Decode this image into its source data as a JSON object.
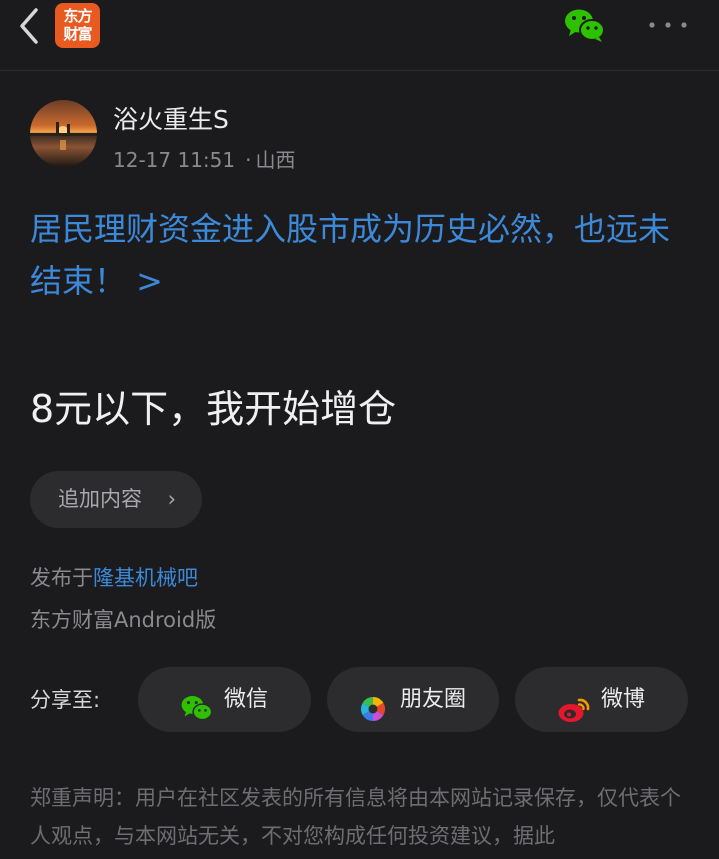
{
  "header": {
    "logo_line1": "东方",
    "logo_line2": "财富"
  },
  "post": {
    "author_name": "浴火重生S",
    "timestamp": "12-17 11:51",
    "location": "山西",
    "headline": "居民理财资金进入股市成为历史必然，也远未结束！ >",
    "body": "8元以下，我开始增仓",
    "append_button": "追加内容",
    "append_chevron": "›",
    "published_prefix": "发布于",
    "published_bar": "隆基机械吧",
    "client": "东方财富Android版"
  },
  "share": {
    "label": "分享至:",
    "items": [
      {
        "label": "微信",
        "icon": "wechat-icon"
      },
      {
        "label": "朋友圈",
        "icon": "moments-icon"
      },
      {
        "label": "微博",
        "icon": "weibo-icon"
      }
    ]
  },
  "disclaimer": "郑重声明：用户在社区发表的所有信息将由本网站记录保存，仅代表个人观点，与本网站无关，不对您构成任何投资建议，据此",
  "colors": {
    "background": "#1b1b1d",
    "link_blue": "#3d89d9",
    "brand_orange": "#e85a20",
    "wechat_green": "#2dc100"
  }
}
